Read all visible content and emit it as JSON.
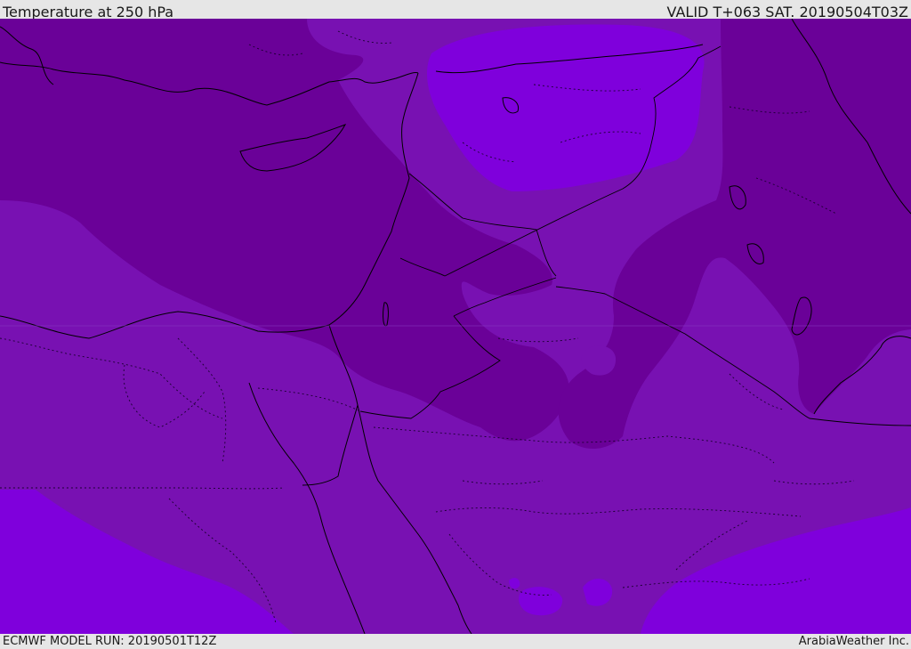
{
  "header": {
    "title": "Temperature at 250 hPa",
    "valid_time": "VALID T+063 SAT. 20190504T03Z"
  },
  "footer": {
    "model_run": "ECMWF MODEL RUN: 20190501T12Z",
    "credit": "ArabiaWeather Inc."
  },
  "map": {
    "variable": "Temperature",
    "level": "250 hPa",
    "colors": {
      "coldest_band": "#6a0198",
      "middle_band": "#7811b2",
      "warmest_band": "#7f00dc",
      "coastline": "#000000",
      "border_dotted": "#1a0030"
    }
  }
}
